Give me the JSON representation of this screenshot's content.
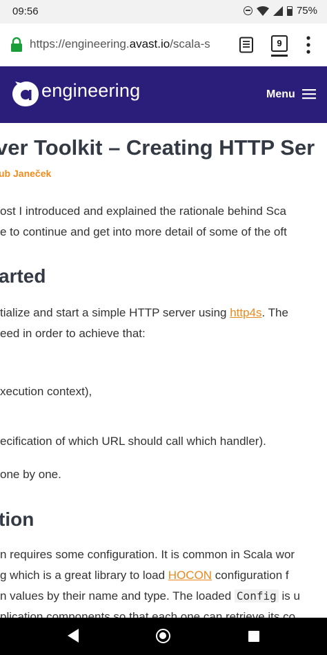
{
  "status": {
    "time": "09:56",
    "battery": "75%"
  },
  "browser": {
    "url_prefix": "https://engineering.",
    "url_host": "avast.io",
    "url_suffix": "/scala-s",
    "tab_count": "9"
  },
  "site": {
    "logo_text": "engineering",
    "menu_label": "Menu",
    "brand_color": "#2b1d7a",
    "accent_color": "#f08a1c"
  },
  "article": {
    "title": "ver Toolkit – Creating HTTP Ser",
    "author": "ub Janeček",
    "p1_line1": "ost I introduced and explained the rationale behind Sca",
    "p1_line2": "e to continue and get into more detail of some of the oft",
    "h_started": "arted",
    "p2_line1_a": "tialize and start a simple HTTP server using ",
    "p2_link": "http4s",
    "p2_line1_b": ". The",
    "p2_line2": "eed in order to achieve that:",
    "list_item_1": "xecution context),",
    "list_item_2": "ecification of which URL should call which handler).",
    "p3": " one by one.",
    "h_config": "tion",
    "p4_line1": "n requires some configuration. It is common in Scala wor",
    "p4_line2_a": "g which is a great library to load ",
    "p4_link": "HOCON",
    "p4_line2_b": " configuration f",
    "p4_line3_a": "n values by their name and type. The loaded ",
    "p4_code": "Config",
    "p4_line3_b": " is u",
    "p4_line4": "plication components so that each one can retrieve its co"
  }
}
